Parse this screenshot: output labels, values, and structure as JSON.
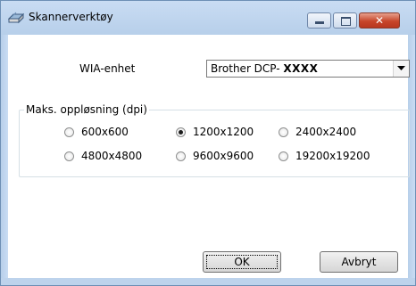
{
  "window": {
    "title": "Skannerverktøy",
    "title_icon": "scanner-icon",
    "controls": [
      "minimize-icon",
      "maximize-icon",
      "close-icon"
    ]
  },
  "device": {
    "label": "WIA-enhet",
    "selected_prefix": "Brother DCP- ",
    "selected_model": "XXXX"
  },
  "resolution": {
    "legend": "Maks. oppløsning (dpi)",
    "options": [
      {
        "label": "600x600",
        "checked": false
      },
      {
        "label": "1200x1200",
        "checked": true
      },
      {
        "label": "2400x2400",
        "checked": false
      },
      {
        "label": "4800x4800",
        "checked": false
      },
      {
        "label": "9600x9600",
        "checked": false
      },
      {
        "label": "19200x19200",
        "checked": false
      }
    ]
  },
  "buttons": {
    "ok": "OK",
    "cancel": "Avbryt"
  }
}
